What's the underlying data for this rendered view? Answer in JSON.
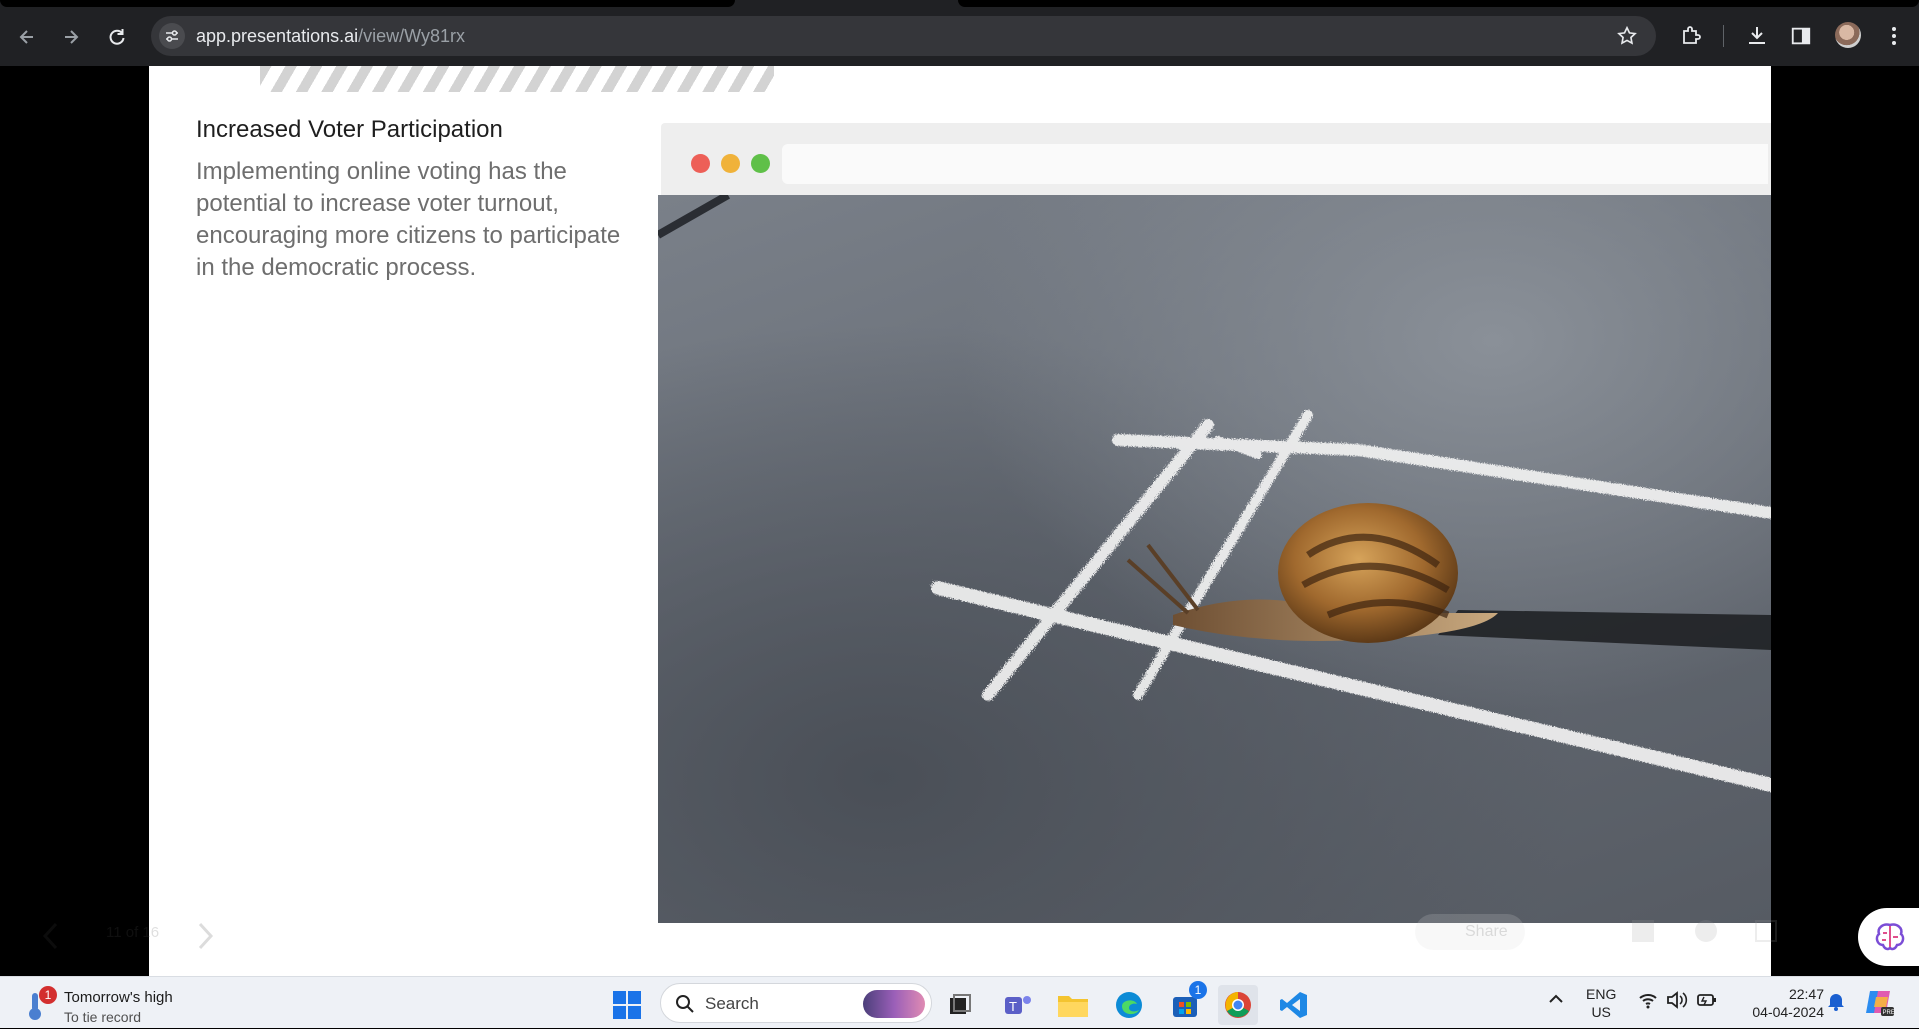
{
  "browser": {
    "url_host": "app.presentations.ai",
    "url_path": "/view/Wy81rx"
  },
  "slide": {
    "heading": "Increased Voter Participation",
    "body": "Implementing online voting has the potential to increase voter turnout, encouraging more citizens to participate in the democratic process.",
    "image_subject": "snail-crossing-chalk-line"
  },
  "controls": {
    "counter": "11 of 16",
    "share_label": "Share"
  },
  "taskbar": {
    "weather_title": "Tomorrow's high",
    "weather_subtitle": "To tie record",
    "weather_badge": "1",
    "search_label": "Search",
    "store_badge": "1",
    "lang_line1": "ENG",
    "lang_line2": "US",
    "time": "22:47",
    "date": "04-04-2024"
  },
  "colors": {
    "mac_red": "#ed5f57",
    "mac_yellow": "#f0b23a",
    "mac_green": "#5fc048"
  }
}
